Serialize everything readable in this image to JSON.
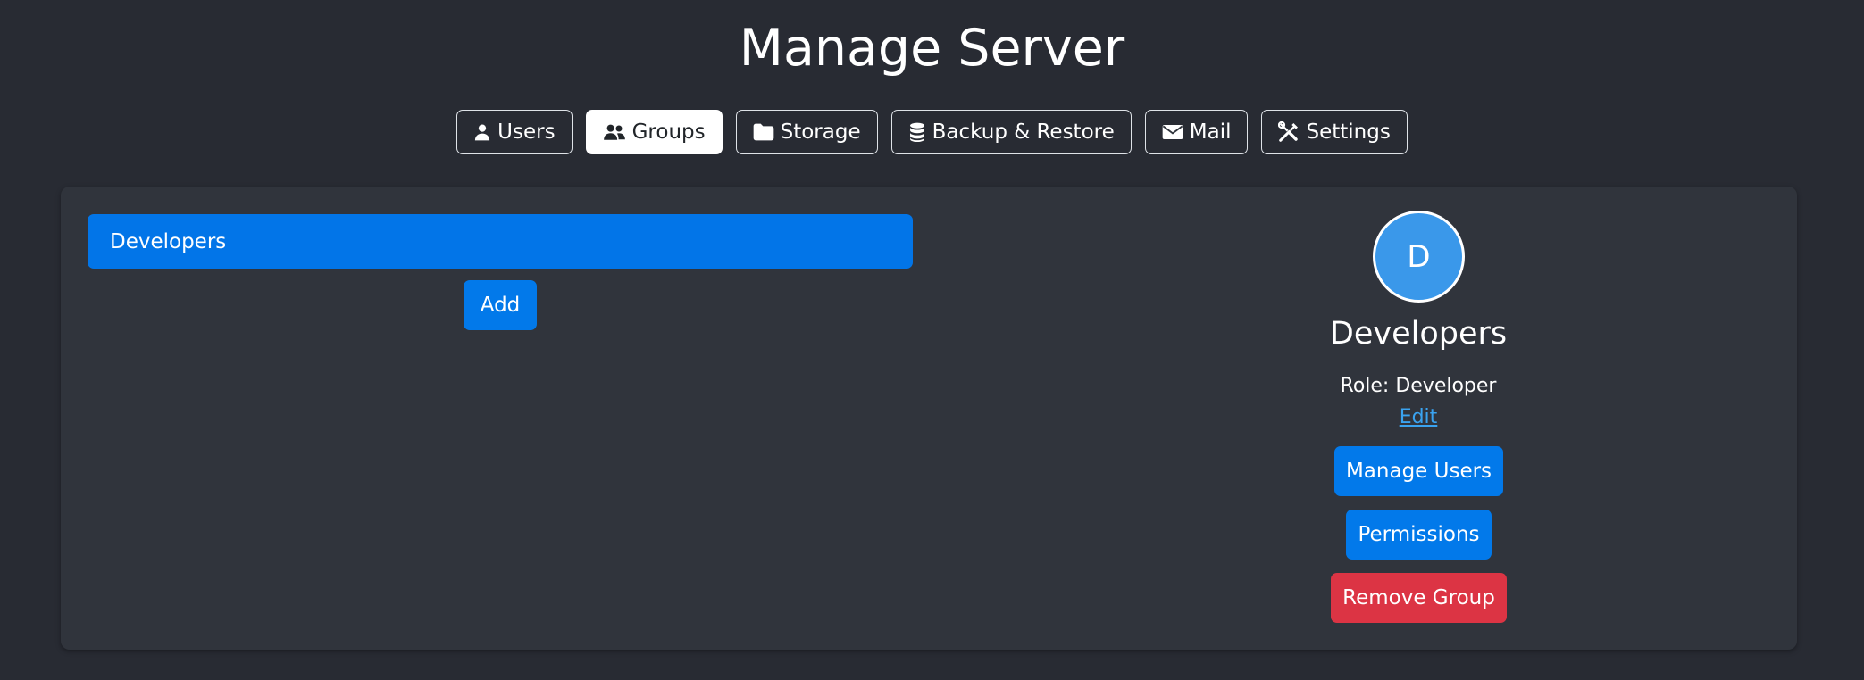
{
  "page_title": "Manage Server",
  "nav": {
    "items": [
      {
        "label": "Users",
        "icon": "user-icon",
        "active": false
      },
      {
        "label": "Groups",
        "icon": "users-icon",
        "active": true
      },
      {
        "label": "Storage",
        "icon": "folder-icon",
        "active": false
      },
      {
        "label": "Backup & Restore",
        "icon": "database-icon",
        "active": false
      },
      {
        "label": "Mail",
        "icon": "envelope-icon",
        "active": false
      },
      {
        "label": "Settings",
        "icon": "tools-icon",
        "active": false
      }
    ]
  },
  "groups": {
    "items": [
      {
        "name": "Developers",
        "selected": true
      }
    ],
    "add_label": "Add"
  },
  "selected_group": {
    "avatar_initial": "D",
    "name": "Developers",
    "role_text": "Role: Developer",
    "edit_label": "Edit",
    "manage_users_label": "Manage Users",
    "permissions_label": "Permissions",
    "remove_label": "Remove Group"
  },
  "colors": {
    "background": "#282b33",
    "panel": "#30343c",
    "primary": "#0279ea",
    "danger": "#dc3444",
    "avatar": "#3a98ea",
    "link": "#3aa3f0"
  }
}
